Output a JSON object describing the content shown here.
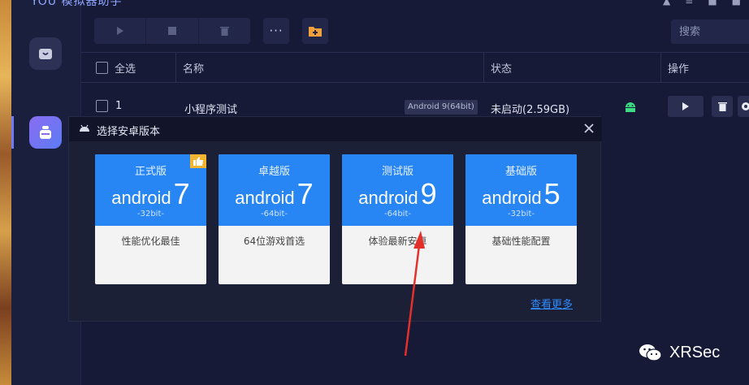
{
  "app": {
    "title": "YOU 模拟器助手"
  },
  "toolbar": {
    "more_label": "···",
    "search_placeholder": "搜索"
  },
  "table": {
    "headers": {
      "select_all": "全选",
      "name": "名称",
      "status": "状态",
      "ops": "操作"
    },
    "rows": [
      {
        "index": "1",
        "name": "小程序测试",
        "badge": "Android 9(64bit)",
        "status": "未启动(2.59GB)"
      }
    ]
  },
  "modal": {
    "title": "选择安卓版本",
    "cards": [
      {
        "label": "正式版",
        "android": "android",
        "version": "7",
        "bit": "-32bit-",
        "desc": "性能优化最佳",
        "recommended": true
      },
      {
        "label": "卓越版",
        "android": "android",
        "version": "7",
        "bit": "-64bit-",
        "desc": "64位游戏首选",
        "recommended": false
      },
      {
        "label": "测试版",
        "android": "android",
        "version": "9",
        "bit": "-64bit-",
        "desc": "体验最新安卓",
        "recommended": false
      },
      {
        "label": "基础版",
        "android": "android",
        "version": "5",
        "bit": "-32bit-",
        "desc": "基础性能配置",
        "recommended": false
      }
    ],
    "more_link": "查看更多"
  },
  "watermark": {
    "text": "XRSec"
  },
  "colors": {
    "card_blue": "#2786f4",
    "annotation_arrow": "#e4302b",
    "link": "#2f8bff"
  }
}
